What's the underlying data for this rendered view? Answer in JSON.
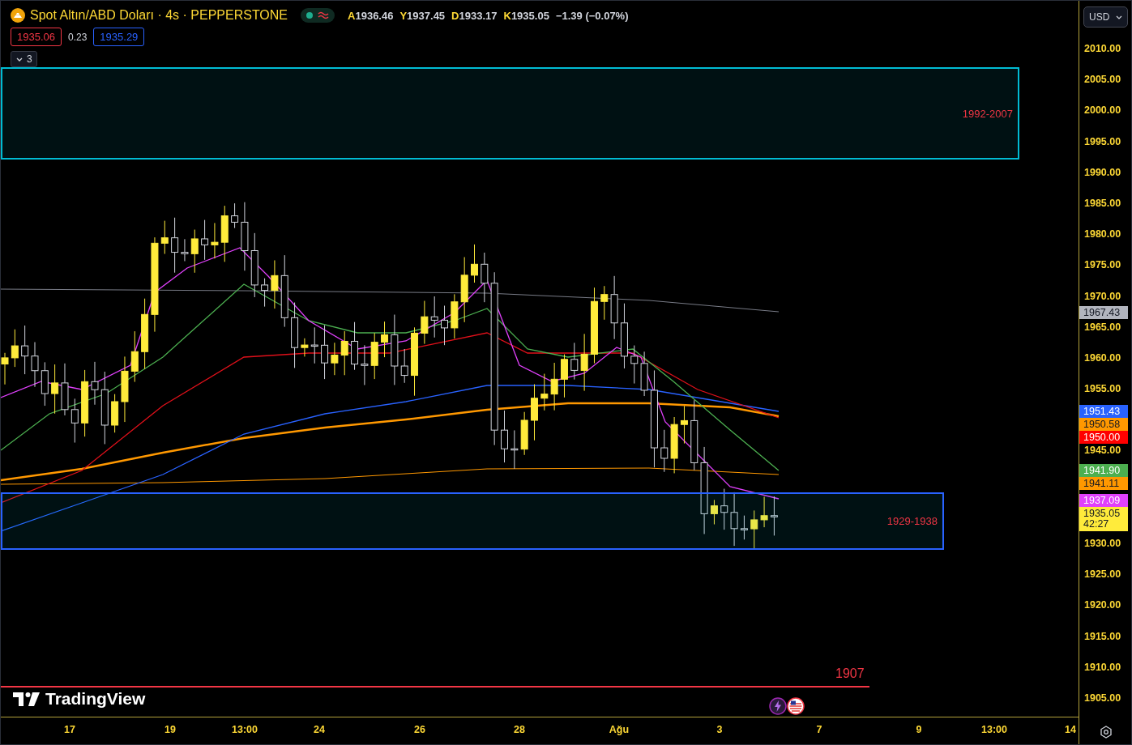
{
  "header": {
    "symbol": "Spot Altın/ABD Doları · 4s · PEPPERSTONE",
    "market_open": true,
    "ohlc": [
      {
        "letter": "A",
        "value": "1936.46"
      },
      {
        "letter": "Y",
        "value": "1937.45"
      },
      {
        "letter": "D",
        "value": "1933.17"
      },
      {
        "letter": "K",
        "value": "1935.05"
      }
    ],
    "change": "−1.39 (−0.07%)"
  },
  "trade": {
    "sell": "1935.06",
    "spread": "0.23",
    "buy": "1935.29"
  },
  "indicators_toggle": {
    "count": "3",
    "expanded": false
  },
  "currency": "USD",
  "zones": [
    {
      "label": "1992-2007",
      "color": "#00bcd4"
    },
    {
      "label": "1929-1938",
      "color": "#2962ff"
    }
  ],
  "level_line": {
    "label": "1907"
  },
  "brand": "TradingView",
  "price_axis": {
    "ticks": [
      "2010.00",
      "2005.00",
      "2000.00",
      "1995.00",
      "1990.00",
      "1985.00",
      "1980.00",
      "1975.00",
      "1970.00",
      "1965.00",
      "1960.00",
      "1955.00",
      "1945.00",
      "1930.00",
      "1925.00",
      "1920.00",
      "1915.00",
      "1910.00",
      "1905.00"
    ]
  },
  "price_labels": [
    {
      "value": "1967.43",
      "color": "#b2b5be"
    },
    {
      "value": "1951.43",
      "color": "#2962ff"
    },
    {
      "value": "1950.58",
      "color": "#ff9800"
    },
    {
      "value": "1950.00",
      "color": "#ff0000"
    },
    {
      "value": "1941.90",
      "color": "#4caf50"
    },
    {
      "value": "1941.11",
      "color": "#ff9800"
    },
    {
      "value": "1937.09",
      "color": "#e040fb"
    },
    {
      "value": "1935.05",
      "color": "#ffeb3b",
      "countdown": "42:27"
    }
  ],
  "time_axis": {
    "ticks": [
      "17",
      "19",
      "13:00",
      "24",
      "26",
      "28",
      "Ağu",
      "3",
      "7",
      "9",
      "13:00",
      "14"
    ]
  }
}
